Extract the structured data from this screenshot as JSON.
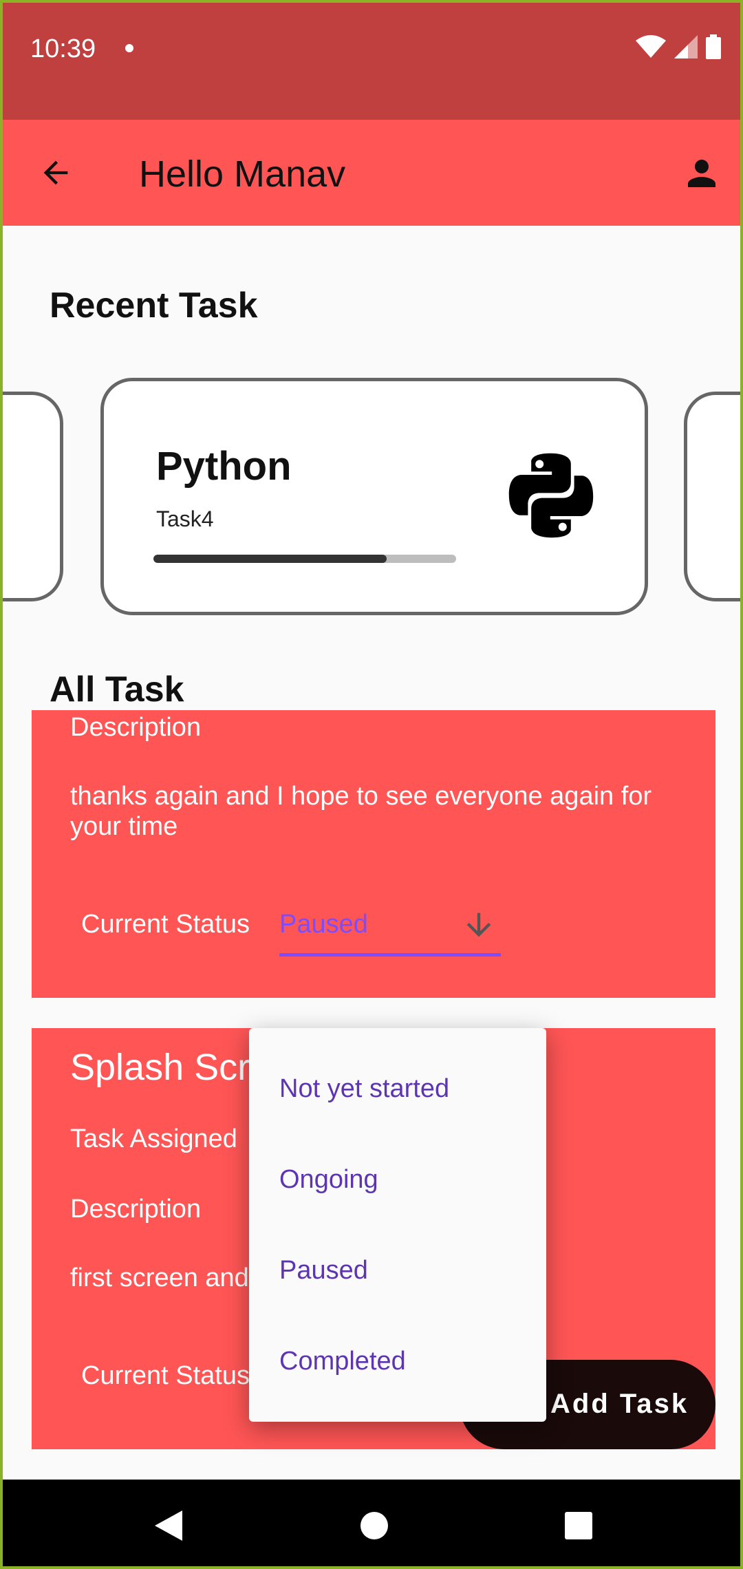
{
  "status_bar": {
    "time": "10:39"
  },
  "app_bar": {
    "title": "Hello Manav"
  },
  "recent_section": {
    "title": "Recent Task"
  },
  "recent_card": {
    "title": "Python",
    "subtitle": "Task4",
    "progress": 0.77
  },
  "all_section": {
    "title": "All Task"
  },
  "tasks": [
    {
      "description_label": "Description",
      "description_line1": "thanks again and I hope to see everyone again for",
      "description_line2": "your time",
      "status_label": "Current Status",
      "status_value": "Paused"
    },
    {
      "title": "Splash Scr",
      "assigned_label": "Task Assigned",
      "description_label": "Description",
      "description": "first screen and",
      "status_label": "Current Status"
    }
  ],
  "dropdown": {
    "options": [
      "Not yet started",
      "Ongoing",
      "Paused",
      "Completed"
    ]
  },
  "fab": {
    "label": "Add Task"
  },
  "colors": {
    "accent": "#FF5555",
    "status_bar": "#C04040",
    "select_accent": "#7C4DFF"
  }
}
